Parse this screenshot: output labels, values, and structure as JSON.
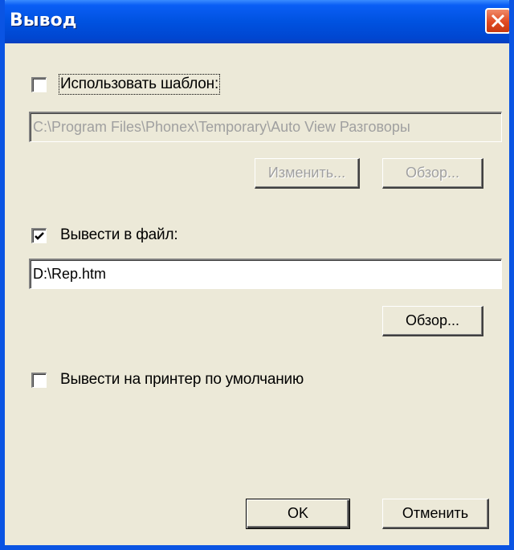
{
  "window": {
    "title": "Вывод"
  },
  "use_template": {
    "label": "Использовать шаблон:",
    "checked": false,
    "path": "C:\\Program Files\\Phonex\\Temporary\\Auto View Разговоры",
    "edit_label": "Изменить...",
    "browse_label": "Обзор..."
  },
  "output_file": {
    "label": "Вывести в файл:",
    "checked": true,
    "path": "D:\\Rep.htm",
    "browse_label": "Обзор..."
  },
  "printer": {
    "label": "Вывести на принтер по умолчанию",
    "checked": false
  },
  "footer": {
    "ok_label": "OK",
    "cancel_label": "Отменить"
  },
  "colors": {
    "titlebar": "#0052e0",
    "dialog_bg": "#ece9d8",
    "close_button": "#e04a22"
  }
}
